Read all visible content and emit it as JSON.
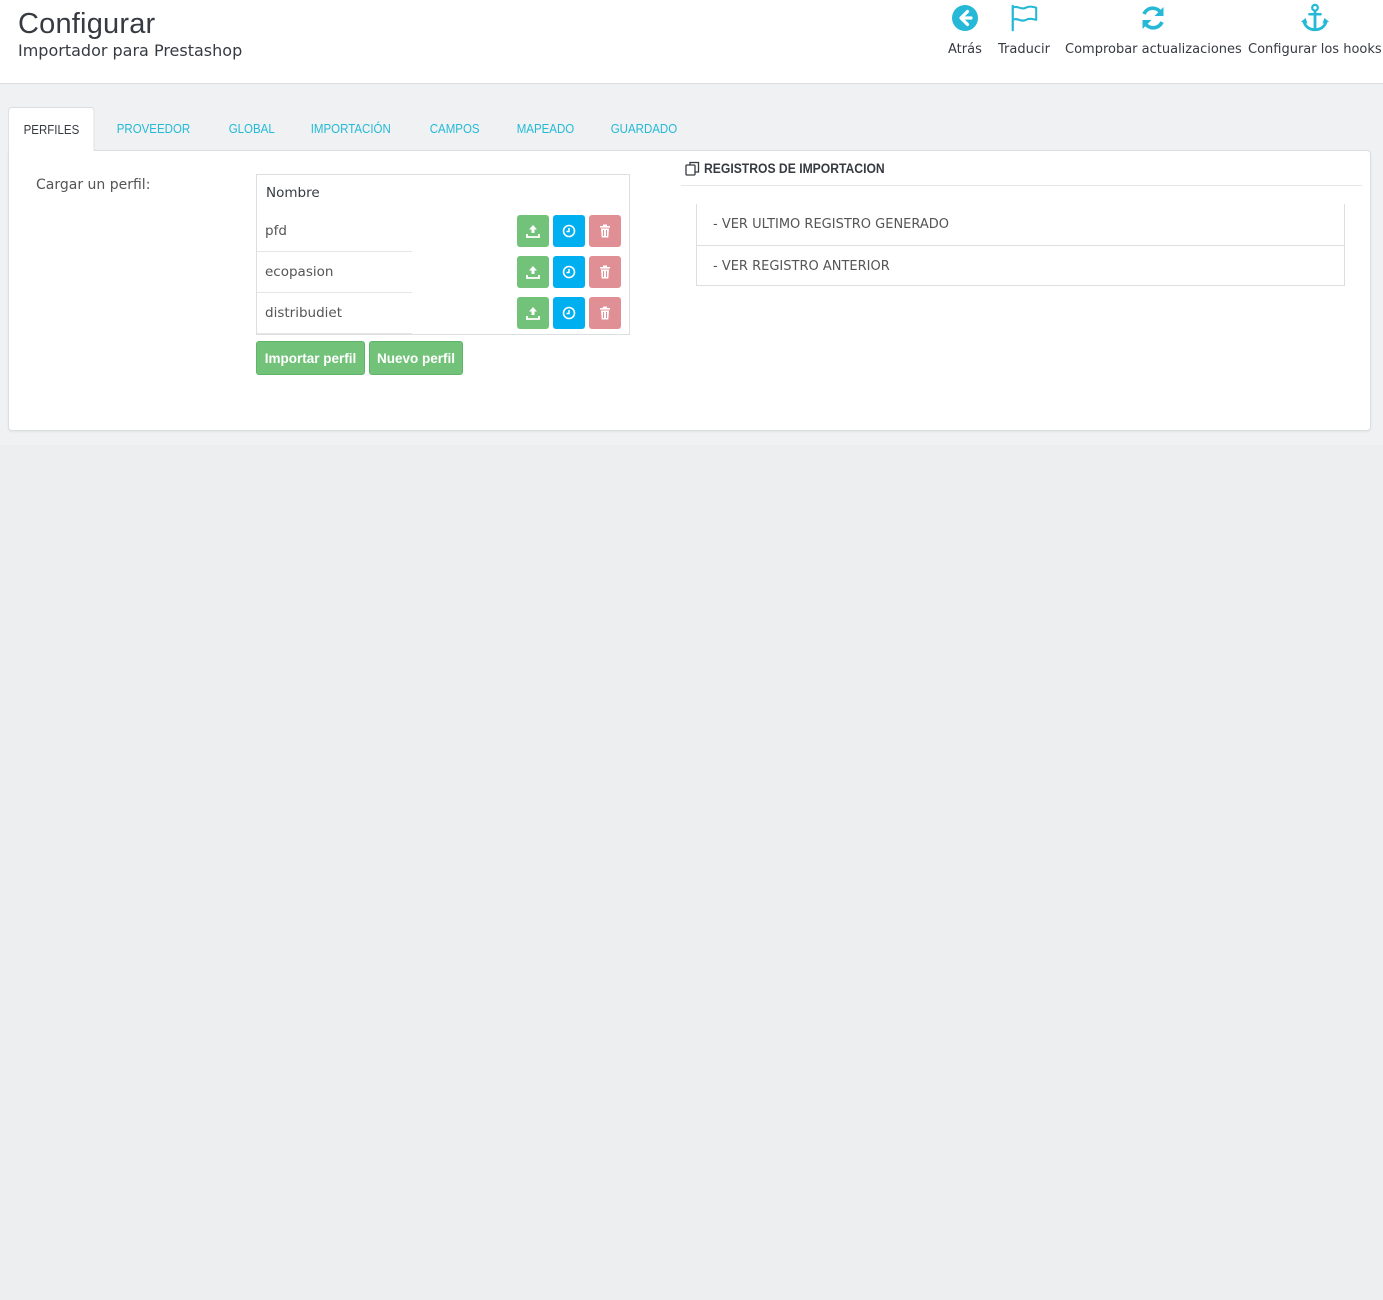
{
  "header": {
    "title": "Configurar",
    "subtitle": "Importador para Prestashop",
    "toolbar": [
      {
        "label": "Atrás",
        "icon": "arrow-circle-left-icon"
      },
      {
        "label": "Traducir",
        "icon": "flag-icon"
      },
      {
        "label": "Comprobar actualizaciones",
        "icon": "refresh-icon"
      },
      {
        "label": "Configurar los hooks",
        "icon": "anchor-icon"
      }
    ]
  },
  "tabs": [
    {
      "label": "PERFILES",
      "active": true
    },
    {
      "label": "PROVEEDOR"
    },
    {
      "label": "GLOBAL"
    },
    {
      "label": "IMPORTACIÓN"
    },
    {
      "label": "CAMPOS"
    },
    {
      "label": "MAPEADO"
    },
    {
      "label": "GUARDADO"
    }
  ],
  "profiles": {
    "load_label": "Cargar un perfil:",
    "column_header": "Nombre",
    "rows": [
      {
        "name": "pfd"
      },
      {
        "name": "ecopasion"
      },
      {
        "name": "distribudiet"
      }
    ],
    "import_button": "Importar perfil",
    "new_button": "Nuevo perfil"
  },
  "logs": {
    "title": "REGISTROS DE IMPORTACION",
    "items": [
      {
        "label": "- VER ULTIMO REGISTRO GENERADO"
      },
      {
        "label": "- VER REGISTRO ANTERIOR"
      }
    ]
  },
  "colors": {
    "accent": "#25b9d7",
    "green": "#72c279",
    "blue": "#00aff0",
    "red": "#e08f95"
  }
}
